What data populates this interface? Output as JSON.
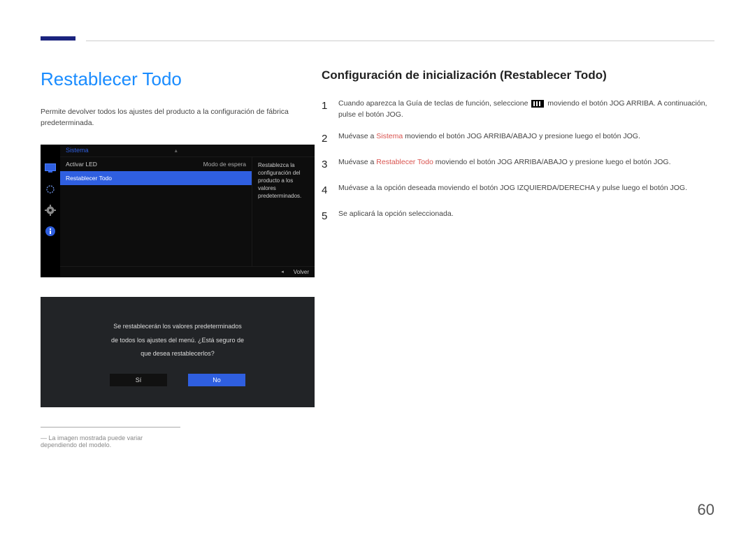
{
  "page_number": "60",
  "left": {
    "heading": "Restablecer Todo",
    "intro": "Permite devolver todos los ajustes del producto a la configuración de fábrica predeterminada.",
    "footnote": "La imagen mostrada puede variar dependiendo del modelo."
  },
  "osd1": {
    "section_title": "Sistema",
    "rows": [
      {
        "label": "Activar LED",
        "value": "Modo de espera"
      },
      {
        "label": "Restablecer Todo",
        "value": ""
      }
    ],
    "selected_index": 1,
    "description": "Restablezca la configuración del producto a los valores predeterminados.",
    "footer_label": "Volver",
    "footer_arrow": "◂"
  },
  "osd2": {
    "message_lines": [
      "Se restablecerán los valores predeterminados",
      "de todos los ajustes del menú. ¿Está seguro de",
      "que desea restablecerlos?"
    ],
    "buttons": [
      {
        "label": "Sí",
        "selected": false
      },
      {
        "label": "No",
        "selected": true
      }
    ]
  },
  "right": {
    "heading": "Configuración de inicialización (Restablecer Todo)",
    "steps": {
      "s1_pre": "Cuando aparezca la Guía de teclas de función, seleccione ",
      "s1_post": " moviendo el botón JOG ARRIBA. A continuación, pulse el botón JOG.",
      "s2_pre": "Muévase a ",
      "s2_hl": "Sistema",
      "s2_post": " moviendo el botón JOG ARRIBA/ABAJO y presione luego el botón JOG.",
      "s3_pre": "Muévase a ",
      "s3_hl": "Restablecer Todo",
      "s3_post": " moviendo el botón JOG ARRIBA/ABAJO y presione luego el botón JOG.",
      "s4": "Muévase a la opción deseada moviendo el botón JOG IZQUIERDA/DERECHA y pulse luego el botón JOG.",
      "s5": "Se aplicará la opción seleccionada."
    }
  }
}
